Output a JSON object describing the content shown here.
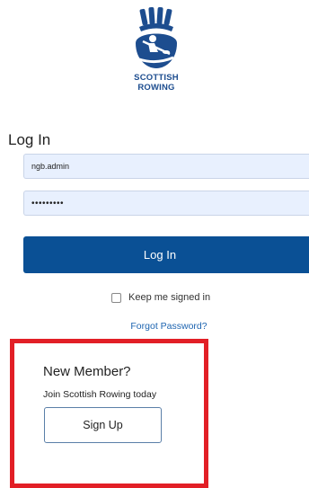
{
  "brand": {
    "name_line1": "SCOTTISH",
    "name_line2": "ROWING",
    "color": "#1d4d8f"
  },
  "login": {
    "title": "Log In",
    "username_value": "ngb.admin",
    "password_value": "•••••••••",
    "submit_label": "Log In",
    "keep_signed_in_label": "Keep me signed in",
    "keep_signed_in_checked": false,
    "forgot_password_label": "Forgot Password?",
    "button_color": "#0a5095",
    "link_color": "#1d64b0"
  },
  "new_member": {
    "title": "New Member?",
    "subtitle": "Join Scottish Rowing today",
    "signup_label": "Sign Up",
    "highlight_color": "#e21f26"
  }
}
